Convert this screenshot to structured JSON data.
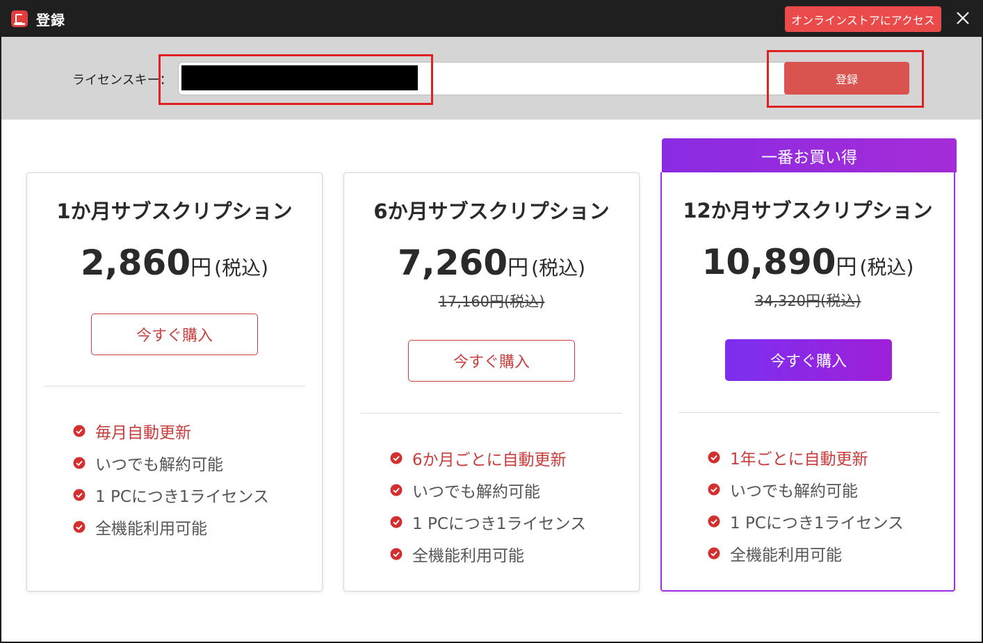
{
  "window": {
    "title": "登録",
    "store_button": "オンラインストアにアクセス"
  },
  "license": {
    "label": "ライセンスキー：",
    "value": "",
    "register_button": "登録"
  },
  "colors": {
    "accent_red": "#d9534f",
    "featured_purple": "#8a2be2"
  },
  "plans": [
    {
      "title": "1か月サブスクリプション",
      "price": "2,860",
      "unit": "円",
      "tax": "(税込)",
      "original_price": "",
      "buy_label": "今すぐ購入",
      "features": [
        "毎月自動更新",
        "いつでも解約可能",
        "1 PCにつき1ライセンス",
        "全機能利用可能"
      ]
    },
    {
      "title": "6か月サブスクリプション",
      "price": "7,260",
      "unit": "円",
      "tax": "(税込)",
      "original_price": "17,160円(税込)",
      "buy_label": "今すぐ購入",
      "features": [
        "6か月ごとに自動更新",
        "いつでも解約可能",
        "1 PCにつき1ライセンス",
        "全機能利用可能"
      ]
    },
    {
      "badge": "一番お買い得",
      "title": "12か月サブスクリプション",
      "price": "10,890",
      "unit": "円",
      "tax": "(税込)",
      "original_price": "34,320円(税込)",
      "buy_label": "今すぐ購入",
      "features": [
        "1年ごとに自動更新",
        "いつでも解約可能",
        "1 PCにつき1ライセンス",
        "全機能利用可能"
      ]
    }
  ]
}
